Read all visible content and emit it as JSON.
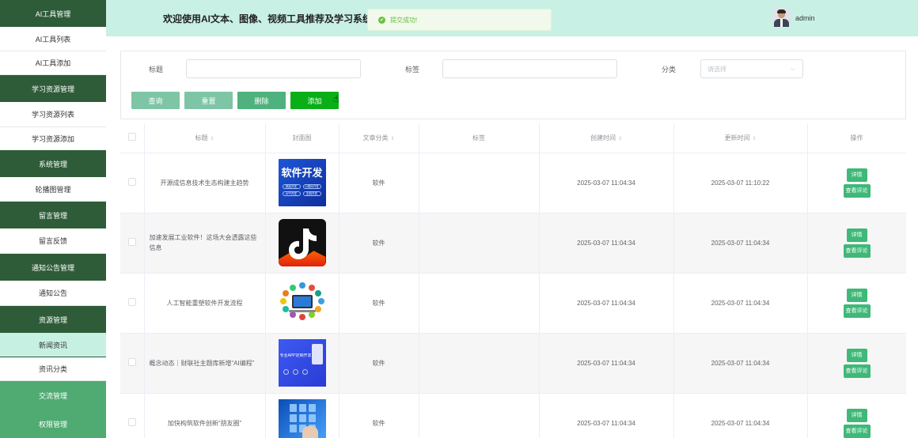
{
  "sidebar": [
    {
      "label": "AI工具管理",
      "kind": "group"
    },
    {
      "label": "AI工具列表",
      "kind": "sub"
    },
    {
      "label": "AI工具添加",
      "kind": "sub"
    },
    {
      "label": "学习资源管理",
      "kind": "group"
    },
    {
      "label": "学习资源列表",
      "kind": "sub"
    },
    {
      "label": "学习资源添加",
      "kind": "sub"
    },
    {
      "label": "系统管理",
      "kind": "group"
    },
    {
      "label": "轮播图管理",
      "kind": "sub"
    },
    {
      "label": "留言管理",
      "kind": "group"
    },
    {
      "label": "留言反馈",
      "kind": "sub"
    },
    {
      "label": "通知公告管理",
      "kind": "group"
    },
    {
      "label": "通知公告",
      "kind": "sub"
    },
    {
      "label": "资源管理",
      "kind": "group"
    },
    {
      "label": "新闻资讯",
      "kind": "active"
    },
    {
      "label": "资讯分类",
      "kind": "sub"
    },
    {
      "label": "交流管理",
      "kind": "light"
    },
    {
      "label": "权限管理",
      "kind": "light"
    }
  ],
  "header": {
    "welcome": "欢迎使用AI文本、图像、视频工具推荐及学习系统",
    "toast": "提交成功!",
    "username": "admin"
  },
  "search": {
    "title_label": "标题",
    "tag_label": "标签",
    "category_label": "分类",
    "category_placeholder": "请选择",
    "buttons": {
      "query": "查询",
      "reset": "重置",
      "delete": "删除",
      "add": "添加"
    }
  },
  "colors": {
    "query": "#7ec5a6",
    "reset": "#7ec5a6",
    "delete": "#4fb27e",
    "add": "#0aaf18"
  },
  "table": {
    "headers": [
      "标题",
      "封面图",
      "文章分类",
      "标签",
      "创建时间",
      "更新时间",
      "操作"
    ],
    "detail_label": "详情",
    "comment_label": "查看评论",
    "rows": [
      {
        "title": "开源成信息技术生态构建主趋势",
        "cover": "cover-software-dev",
        "cover_text": "软件开发",
        "cover_tags": [
          "精品开发",
          "小程序开发",
          "APP开发",
          "定制开发"
        ],
        "category": "软件",
        "tag": "",
        "created": "2025-03-07 11:04:34",
        "updated": "2025-03-07 11:10:22"
      },
      {
        "title": "加速发展工业软件！这场大会透露这些信息",
        "cover": "cover-tiktok-logo",
        "category": "软件",
        "tag": "",
        "created": "2025-03-07 11:04:34",
        "updated": "2025-03-07 11:04:34"
      },
      {
        "title": "人工智能重塑软件开发流程",
        "cover": "cover-laptop-icons",
        "category": "软件",
        "tag": "",
        "created": "2025-03-07 11:04:34",
        "updated": "2025-03-07 11:04:34"
      },
      {
        "title": "概念动态｜财联社主题库新增“AI编程”",
        "cover": "cover-app-custom",
        "cover_text": "专业APP定制开发",
        "category": "软件",
        "tag": "",
        "created": "2025-03-07 11:04:34",
        "updated": "2025-03-07 11:04:34"
      },
      {
        "title": "加快构筑软件创新“朋友圈”",
        "cover": "cover-touch-screen",
        "category": "软件",
        "tag": "",
        "created": "2025-03-07 11:04:34",
        "updated": "2025-03-07 11:04:34"
      }
    ]
  }
}
